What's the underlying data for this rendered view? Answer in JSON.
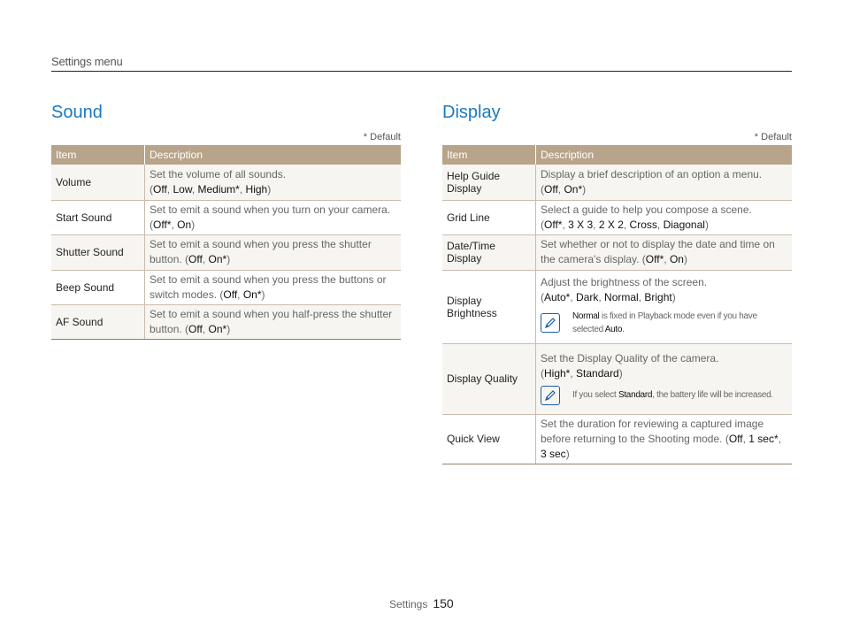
{
  "header": {
    "title": "Settings menu"
  },
  "sound": {
    "title": "Sound",
    "default_note": "* Default",
    "columns": [
      "Item",
      "Description"
    ],
    "rows": [
      {
        "item": "Volume",
        "desc_text": "Set the volume of all sounds.",
        "options": [
          "Off",
          "Low",
          "Medium*",
          "High"
        ]
      },
      {
        "item": "Start Sound",
        "desc_text": "Set to emit a sound when you turn on your camera.",
        "options": [
          "Off*",
          "On"
        ]
      },
      {
        "item": "Shutter Sound",
        "desc_text": "Set to emit a sound when you press the shutter button.",
        "options": [
          "Off",
          "On*"
        ]
      },
      {
        "item": "Beep Sound",
        "desc_text": "Set to emit a sound when you press the buttons or switch modes.",
        "options": [
          "Off",
          "On*"
        ]
      },
      {
        "item": "AF Sound",
        "desc_text": "Set to emit a sound when you half-press the shutter button.",
        "options": [
          "Off",
          "On*"
        ]
      }
    ]
  },
  "display": {
    "title": "Display",
    "default_note": "* Default",
    "columns": [
      "Item",
      "Description"
    ],
    "rows": [
      {
        "item": "Help Guide Display",
        "desc_text": "Display a brief description of an option a menu.",
        "options": [
          "Off",
          "On*"
        ]
      },
      {
        "item": "Grid Line",
        "desc_text": "Select a guide to help you compose a scene.",
        "options": [
          "Off*",
          "3 X 3",
          "2 X 2",
          "Cross",
          "Diagonal"
        ]
      },
      {
        "item": "Date/Time Display",
        "desc_text": "Set whether or not to display the date and time on the camera's display.",
        "options": [
          "Off*",
          "On"
        ]
      },
      {
        "item": "Display Brightness",
        "desc_text": "Adjust the brightness of the screen.",
        "options": [
          "Auto*",
          "Dark",
          "Normal",
          "Bright"
        ],
        "note": {
          "strong_1": "Normal",
          "text_1": " is fixed in Playback mode even if you have selected ",
          "strong_2": "Auto",
          "text_2": "."
        }
      },
      {
        "item": "Display Quality",
        "desc_text": "Set the Display Quality of the camera.",
        "options": [
          "High*",
          "Standard"
        ],
        "note": {
          "text_1": "If you select ",
          "strong_1": "Standard",
          "text_2": ", the battery life will be increased."
        }
      },
      {
        "item": "Quick View",
        "desc_text": "Set the duration for reviewing a captured image before returning to the Shooting mode.",
        "options": [
          "Off",
          "1 sec*",
          "3 sec"
        ]
      }
    ]
  },
  "footer": {
    "label": "Settings",
    "page_number": "150"
  }
}
